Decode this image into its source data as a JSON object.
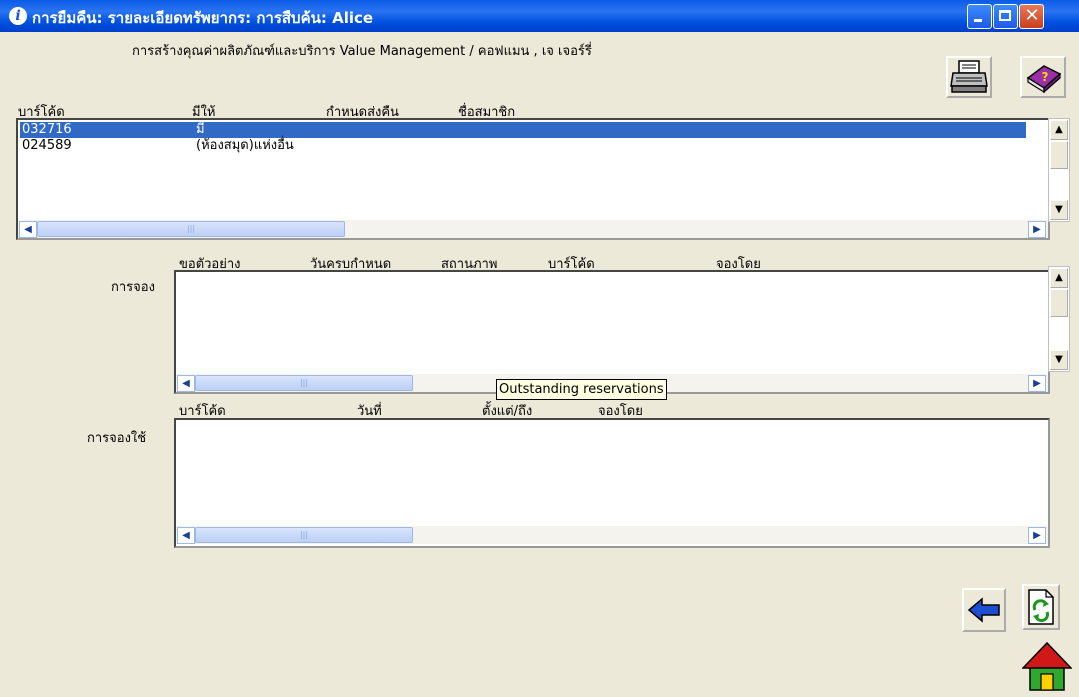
{
  "window": {
    "title": "การยืมคืน: รายละเอียดทรัพยากร: การสืบค้น: Alice",
    "info_icon": "info-icon",
    "min_icon": "minimize-icon",
    "max_icon": "maximize-icon",
    "close_icon": "close-icon"
  },
  "book_title": "การสร้างคุณค่าผลิตภัณฑ์และบริการ Value Management / คอฟแมน , เจ เจอร์รี่",
  "toolbar": {
    "print_icon": "printer-icon",
    "help_icon": "help-book-icon"
  },
  "items": {
    "headers": [
      "บาร์โค้ด",
      "มีให้",
      "กำหนดส่งคืน",
      "ชื่อสมาชิก"
    ],
    "rows": [
      {
        "barcode": "032716",
        "available": "มี",
        "due": "",
        "member": ""
      },
      {
        "barcode": "024589",
        "available": "(ห้องสมุด)แห่งอื่น",
        "due": "",
        "member": ""
      }
    ],
    "selected_index": 0
  },
  "reservations": {
    "label": "การจอง",
    "headers": [
      "ขอตัวอย่าง",
      "วันครบกำหนด",
      "สถานภาพ",
      "บาร์โค้ด",
      "จองโดย"
    ],
    "rows": []
  },
  "bookings": {
    "label": "การจองใช้",
    "headers": [
      "บาร์โค้ด",
      "วันที่",
      "ตั้งแต่/ถึง",
      "จองโดย"
    ],
    "rows": []
  },
  "tooltip": "Outstanding reservations",
  "nav": {
    "back_icon": "back-arrow-icon",
    "refresh_icon": "refresh-icon",
    "home_icon": "home-icon"
  },
  "colors": {
    "titlebar": "#0a5be6",
    "selection": "#316ac5",
    "tooltip_bg": "#ffffe1",
    "home_roof": "#d01818",
    "home_body": "#2ea82e"
  }
}
